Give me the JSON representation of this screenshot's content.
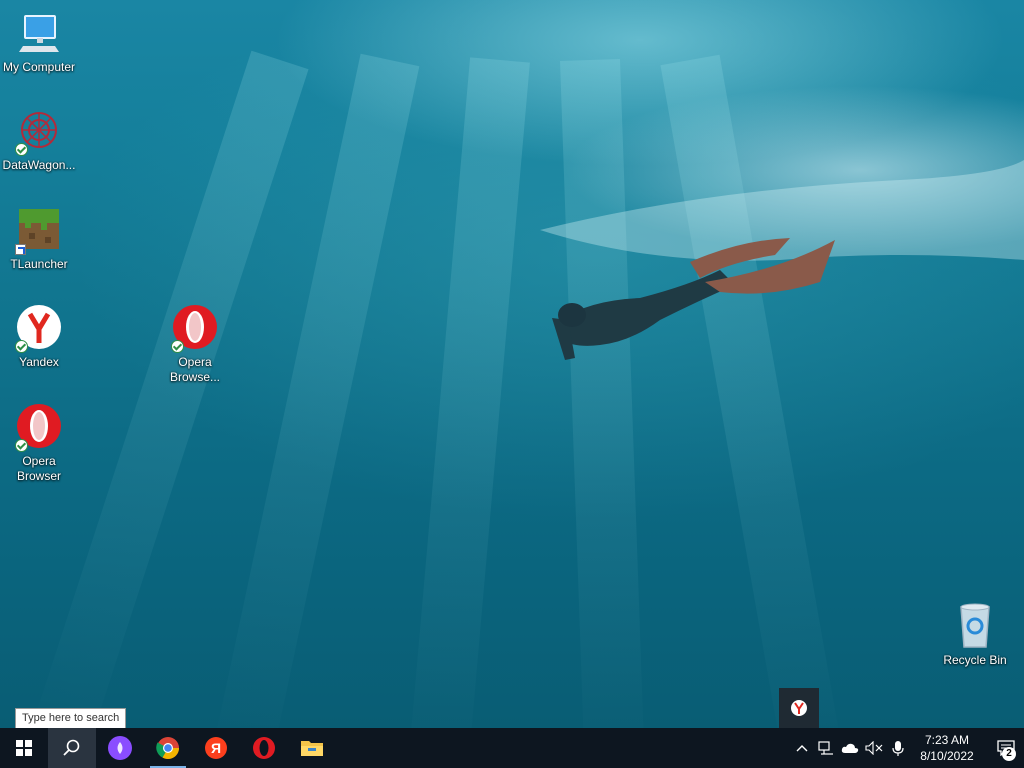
{
  "desktop": {
    "icons": {
      "my_computer": "My Computer",
      "datawagon": "DataWagon...",
      "tlauncher": "TLauncher",
      "yandex": "Yandex",
      "opera_browser": "Opera Browser",
      "opera_browse_2": "Opera Browse...",
      "recycle_bin": "Recycle Bin"
    }
  },
  "search": {
    "tooltip": "Type here to search"
  },
  "taskbar": {
    "apps": [
      "start-icon",
      "search-icon",
      "alice-icon",
      "chrome-icon",
      "yandex-browser-icon",
      "opera-icon",
      "file-explorer-icon"
    ]
  },
  "tray": {
    "time": "7:23 AM",
    "date": "8/10/2022",
    "notification_count": "2"
  },
  "colors": {
    "taskbar": "#0d1620",
    "water": "#117690",
    "opera_red": "#e01b22",
    "yandex_red": "#fc3f1d"
  }
}
